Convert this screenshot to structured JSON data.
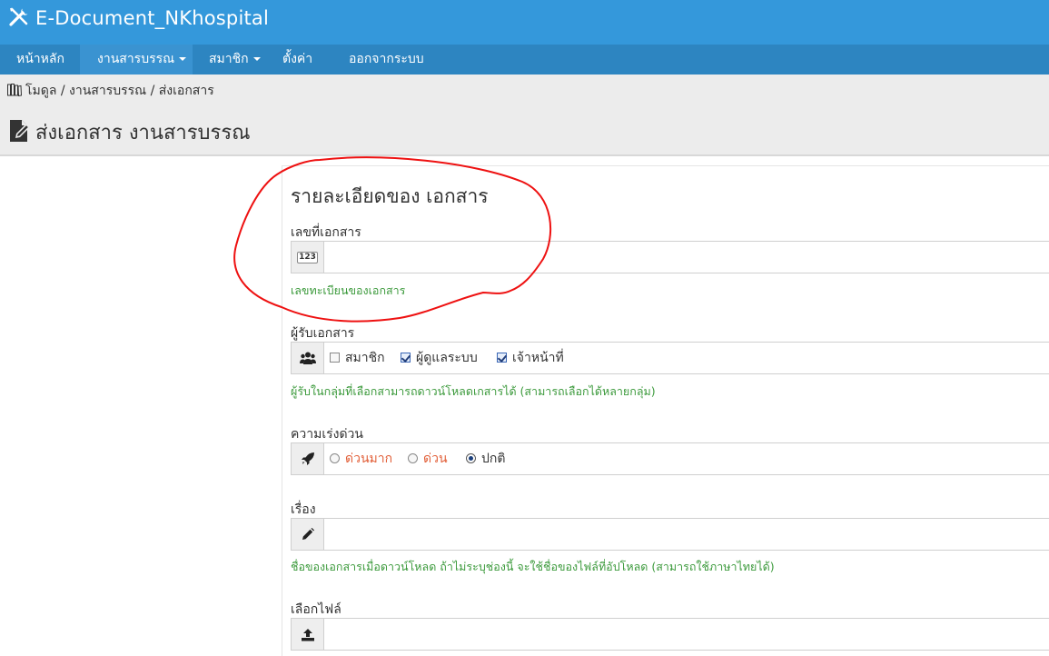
{
  "app": {
    "title": "E-Document_NKhospital",
    "logo_icon": "wrench-screwdriver-icon",
    "accent": "#3498db",
    "nav_bg": "#2d85c1"
  },
  "nav": {
    "items": [
      {
        "label": "หน้าหลัก",
        "has_dropdown": false,
        "active": false
      },
      {
        "label": "งานสารบรรณ",
        "has_dropdown": true,
        "active": true
      },
      {
        "label": "สมาชิก",
        "has_dropdown": true,
        "active": false
      },
      {
        "label": "ตั้งค่า",
        "has_dropdown": false,
        "active": false
      },
      {
        "label": "ออกจากระบบ",
        "has_dropdown": false,
        "active": false
      }
    ]
  },
  "breadcrumb": {
    "icon": "books-icon",
    "text": "โมดูล / งานสารบรรณ / ส่งเอกสาร"
  },
  "page": {
    "title": "ส่งเอกสาร งานสารบรรณ",
    "title_icon": "document-edit-icon"
  },
  "form": {
    "section_title": "รายละเอียดของ เอกสาร",
    "doc_number": {
      "label": "เลขที่เอกสาร",
      "value": "",
      "icon": "123",
      "help": "เลขทะเบียนของเอกสาร"
    },
    "recipients": {
      "label": "ผู้รับเอกสาร",
      "icon": "users-icon",
      "options": [
        {
          "label": "สมาชิก",
          "checked": false
        },
        {
          "label": "ผู้ดูแลระบบ",
          "checked": true
        },
        {
          "label": "เจ้าหน้าที่",
          "checked": true
        }
      ],
      "help": "ผู้รับในกลุ่มที่เลือกสามารถดาวน์โหลดเกสารได้ (สามารถเลือกได้หลายกลุ่ม)"
    },
    "urgency": {
      "label": "ความเร่งด่วน",
      "icon": "rocket-icon",
      "options": [
        {
          "label": "ด่วนมาก",
          "selected": false,
          "color": "#e2603a"
        },
        {
          "label": "ด่วน",
          "selected": false,
          "color": "#e2603a"
        },
        {
          "label": "ปกติ",
          "selected": true,
          "color": "#333333"
        }
      ]
    },
    "subject": {
      "label": "เรื่อง",
      "value": "",
      "icon": "pencil-icon",
      "help": "ชื่อของเอกสารเมื่อดาวน์โหลด ถ้าไม่ระบุช่องนี้ จะใช้ชื่อของไฟล์ที่อัปโหลด (สามารถใช้ภาษาไทยได้)"
    },
    "file": {
      "label": "เลือกไฟล์",
      "icon": "upload-icon"
    }
  },
  "help_color": "#3c9a3c"
}
